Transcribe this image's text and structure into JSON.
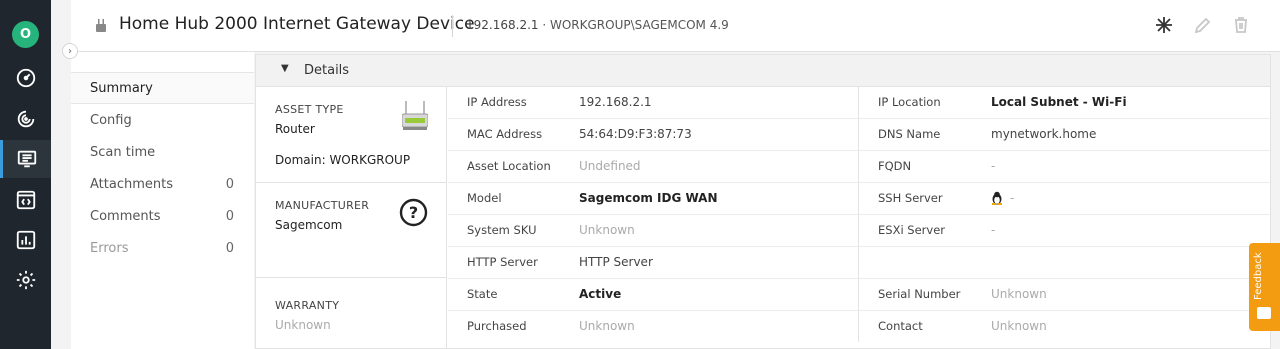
{
  "user": {
    "initial": "O"
  },
  "rail": [
    {
      "name": "dashboard-icon"
    },
    {
      "name": "discovery-icon"
    },
    {
      "name": "assets-icon"
    },
    {
      "name": "software-icon"
    },
    {
      "name": "reports-icon"
    },
    {
      "name": "settings-icon"
    }
  ],
  "header": {
    "title": "Home Hub 2000 Internet Gateway Device",
    "ip": "192.168.2.1",
    "ip_rest": " · WORKGROUP\\SAGEMCOM 4.9"
  },
  "subnav": [
    {
      "label": "Summary",
      "count": ""
    },
    {
      "label": "Config",
      "count": ""
    },
    {
      "label": "Scan time",
      "count": ""
    },
    {
      "label": "Attachments",
      "count": "0"
    },
    {
      "label": "Comments",
      "count": "0"
    },
    {
      "label": "Errors",
      "count": "0"
    }
  ],
  "details": {
    "section_label": "Details",
    "asset_type_caption": "ASSET TYPE",
    "asset_type": "Router",
    "domain_prefix": "Domain:",
    "domain": "WORKGROUP",
    "manufacturer_caption": "MANUFACTURER",
    "manufacturer": "Sagemcom",
    "warranty_caption": "WARRANTY",
    "warranty": "Unknown",
    "left_fields": [
      {
        "key": "IP Address",
        "value": "192.168.2.1"
      },
      {
        "key": "MAC Address",
        "value": "54:64:D9:F3:87:73"
      },
      {
        "key": "Asset Location",
        "value": "Undefined"
      },
      {
        "key": "Model",
        "value": "Sagemcom IDG WAN"
      },
      {
        "key": "System SKU",
        "value": "Unknown"
      },
      {
        "key": "HTTP Server",
        "value": "HTTP Server"
      },
      {
        "key": "State",
        "value": "Active"
      },
      {
        "key": "Purchased",
        "value": "Unknown"
      }
    ],
    "right_fields": [
      {
        "key": "IP Location",
        "value": "Local Subnet - Wi-Fi"
      },
      {
        "key": "DNS Name",
        "value": "mynetwork.home"
      },
      {
        "key": "FQDN",
        "value": "-"
      },
      {
        "key": "SSH Server",
        "value": "-"
      },
      {
        "key": "ESXi Server",
        "value": "-"
      },
      {
        "key": "",
        "value": ""
      },
      {
        "key": "Serial Number",
        "value": "Unknown"
      },
      {
        "key": "Contact",
        "value": "Unknown"
      }
    ]
  },
  "feedback_label": "Feedback",
  "colors": {
    "rail_bg": "#1f262d",
    "accent": "#3b9dde",
    "avatar": "#27b37c",
    "feedback": "#f39c12"
  }
}
